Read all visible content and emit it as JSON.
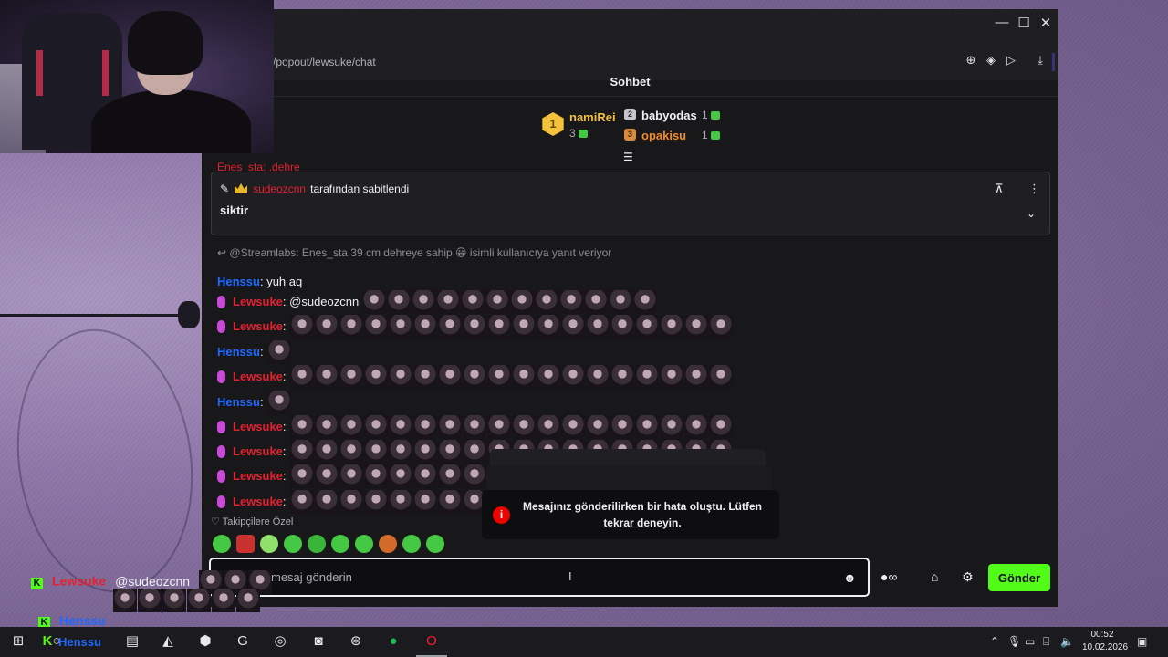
{
  "window": {
    "url": "/popout/lewsuke/chat",
    "minimize": "—",
    "maximize": "☐",
    "close": "✕"
  },
  "chat": {
    "title": "Sohbet",
    "leaderboard": {
      "first": {
        "rank": "1",
        "name": "namiRei",
        "count": "3"
      },
      "second": {
        "rank": "2",
        "name": "babyodas",
        "count": "1"
      },
      "third": {
        "rank": "3",
        "name": "opakisu",
        "count": "1"
      }
    },
    "peek_message": "Enes_sta: .dehre",
    "pinned": {
      "user": "sudeozcnn",
      "suffix": "tarafından sabitlendi",
      "text": "siktir"
    },
    "reply_line": "@Streamlabs: Enes_sta 39 cm dehreye sahip",
    "reply_suffix": "isimli kullanıcıya yanıt veriyor",
    "messages": [
      {
        "user": "Henssu",
        "text": ": yuh aq",
        "mic": false,
        "color": "blue",
        "emotes": 0
      },
      {
        "user": "Lewsuke",
        "text": ": @sudeozcnn",
        "mic": true,
        "color": "red",
        "emotes": 12
      },
      {
        "user": "Lewsuke",
        "text": ":",
        "mic": true,
        "color": "red",
        "emotes": 18
      },
      {
        "user": "Henssu",
        "text": ":",
        "mic": false,
        "color": "blue",
        "emotes": 1
      },
      {
        "user": "Lewsuke",
        "text": ":",
        "mic": true,
        "color": "red",
        "emotes": 18
      },
      {
        "user": "Henssu",
        "text": ":",
        "mic": false,
        "color": "blue",
        "emotes": 1
      },
      {
        "user": "Lewsuke",
        "text": ":",
        "mic": true,
        "color": "red",
        "emotes": 18
      },
      {
        "user": "Lewsuke",
        "text": ":",
        "mic": true,
        "color": "red",
        "emotes": 18
      },
      {
        "user": "Lewsuke",
        "text": ":",
        "mic": true,
        "color": "red",
        "emotes": 8
      },
      {
        "user": "Lewsuke",
        "text": ":",
        "mic": true,
        "color": "red",
        "emotes": 8
      }
    ],
    "toast": "Mesajınız gönderilirken bir hata oluştu. Lütfen tekrar deneyin.",
    "followers_label": "Takipçilere Özel",
    "input_placeholder": "mesaj gönderin",
    "send_label": "Gönder"
  },
  "overlay": {
    "line1_user": "Lewsuke",
    "line1_text": "@sudeozcnn",
    "line2_user": "Henssu",
    "line3_user": "Henssu"
  },
  "taskbar": {
    "time": "00:52",
    "date": "10.02.2026"
  },
  "colors": {
    "kick_green": "#53fc18",
    "chat_bg": "#18181b",
    "user_red": "#e3212f",
    "user_blue": "#1e69ff",
    "error_red": "#eb0400"
  }
}
